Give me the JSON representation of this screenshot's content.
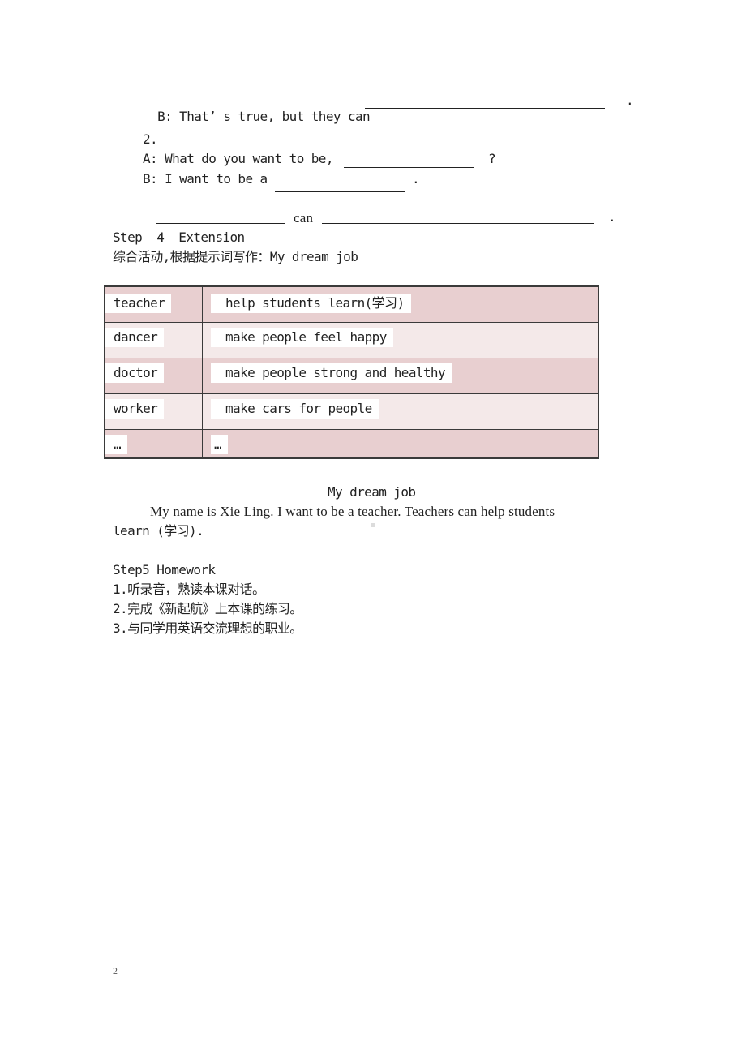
{
  "dialogue1": {
    "b_line": "B: That’ s true, but they can",
    "b_end": "."
  },
  "dialogue2": {
    "number": "2.",
    "a_line": "A: What do you want to be,",
    "a_end": "?",
    "b_line": "B: I want to be a",
    "b_end": ".",
    "can_word": "can",
    "can_end": "."
  },
  "step4": {
    "heading": "Step  4  Extension",
    "instruction": "综合活动,根据提示词写作：My dream job"
  },
  "table": {
    "rows": [
      {
        "job": "teacher",
        "description": "help students learn(学习)"
      },
      {
        "job": "dancer",
        "description": "make people feel happy"
      },
      {
        "job": "doctor",
        "description": "make  people strong and healthy"
      },
      {
        "job": "worker",
        "description": "make cars for people"
      },
      {
        "job": "…",
        "description": "…"
      }
    ]
  },
  "essay": {
    "title": "My dream job",
    "body_line1": "My name is Xie Ling. I want to be a teacher. Teachers can help students",
    "body_line2": "learn (学习)."
  },
  "step5": {
    "heading": "Step5 Homework",
    "items": [
      "1.听录音，熟读本课对话。",
      "2.完成《新起航》上本课的练习。",
      "3.与同学用英语交流理想的职业。"
    ]
  },
  "page_number": "2"
}
